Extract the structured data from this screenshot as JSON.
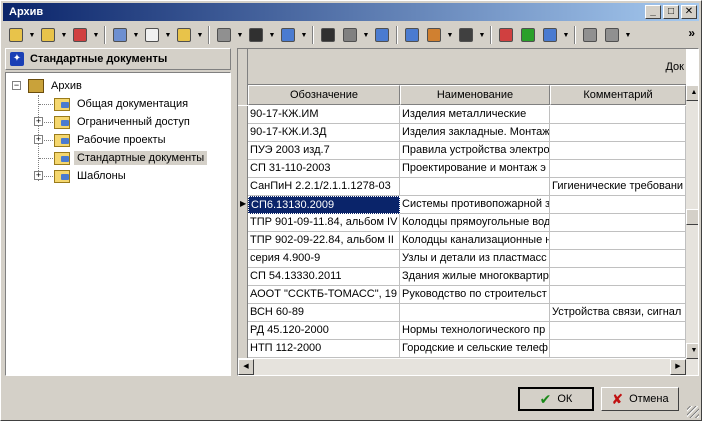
{
  "window": {
    "title": "Архив"
  },
  "titlebar_buttons": {
    "minimize": "_",
    "maximize": "□",
    "close": "✕"
  },
  "toolbar": {
    "overflow": "»",
    "buttons": [
      {
        "icon": "new-folder-icon",
        "color": "#e8c34a"
      },
      {
        "icon": "move-up-icon",
        "color": "#e8c34a"
      },
      {
        "icon": "delete-folder-icon",
        "color": "#d04040"
      },
      {
        "icon": "properties-icon",
        "color": "#6d8fd0"
      },
      {
        "icon": "document-icon",
        "color": "#f0f0f0"
      },
      {
        "icon": "help-icon",
        "color": "#e8c34a"
      },
      {
        "icon": "print-icon",
        "color": "#909090"
      },
      {
        "icon": "run-icon",
        "color": "#303030"
      },
      {
        "icon": "filter-icon",
        "color": "#4a7bd0"
      },
      {
        "icon": "find-icon",
        "color": "#303030"
      },
      {
        "icon": "tools-icon",
        "color": "#808080"
      },
      {
        "icon": "copy-to-icon",
        "color": "#4a7bd0"
      },
      {
        "icon": "structure-icon",
        "color": "#4a7bd0"
      },
      {
        "icon": "report-icon",
        "color": "#d08030"
      },
      {
        "icon": "user-icon",
        "color": "#404040"
      },
      {
        "icon": "calendar-icon",
        "color": "#d04040"
      },
      {
        "icon": "go-icon",
        "color": "#2aa02a"
      },
      {
        "icon": "refresh-icon",
        "color": "#4a7bd0"
      },
      {
        "icon": "archive-folder-icon",
        "color": "#909090"
      },
      {
        "icon": "settings-icon",
        "color": "#909090"
      }
    ]
  },
  "left_panel": {
    "header": "Стандартные документы",
    "tree": [
      {
        "label": "Архив",
        "level": 0,
        "expander": "−",
        "selected": false
      },
      {
        "label": "Общая документация",
        "level": 1,
        "expander": "",
        "selected": false
      },
      {
        "label": "Ограниченный доступ",
        "level": 1,
        "expander": "+",
        "selected": false
      },
      {
        "label": "Рабочие проекты",
        "level": 1,
        "expander": "+",
        "selected": false
      },
      {
        "label": "Стандартные документы",
        "level": 1,
        "expander": "",
        "selected": true
      },
      {
        "label": "Шаблоны",
        "level": 1,
        "expander": "+",
        "selected": false
      }
    ]
  },
  "grid": {
    "group_header": "Док",
    "columns": [
      "Обозначение",
      "Наименование",
      "Комментарий"
    ],
    "current_row_marker": "▶",
    "selected_row": 5,
    "rows": [
      [
        "90-17-КЖ.ИМ",
        "Изделия металлические",
        ""
      ],
      [
        "90-17-КЖ.И.ЗД",
        "Изделия закладные. Монтаж",
        ""
      ],
      [
        "ПУЭ 2003 изд.7",
        "Правила устройства электро",
        ""
      ],
      [
        "СП 31-110-2003",
        "Проектирование и монтаж э",
        ""
      ],
      [
        "СанПиН 2.2.1/2.1.1.1278-03",
        "",
        "Гигиенические требовани"
      ],
      [
        "СП6.13130.2009",
        "Системы противопожарной з",
        ""
      ],
      [
        "ТПР 901-09-11.84, альбом IV",
        "Колодцы прямоугольные вод",
        ""
      ],
      [
        "ТПР 902-09-22.84, альбом II",
        "Колодцы канализационные н",
        ""
      ],
      [
        "серия 4.900-9",
        "Узлы и детали из пластмасс",
        ""
      ],
      [
        "СП 54.13330.2011",
        "Здания жилые многоквартир",
        ""
      ],
      [
        "АООТ \"ССКТБ-ТОМАСС\", 19",
        "Руководство по строительст",
        ""
      ],
      [
        "ВСН 60-89",
        "",
        "Устройства связи, сигнал"
      ],
      [
        "РД 45.120-2000",
        "Нормы технологического пр",
        ""
      ],
      [
        "НТП 112-2000",
        "Городские и сельские телеф",
        ""
      ]
    ]
  },
  "buttons": {
    "ok": "ОК",
    "cancel": "Отмена"
  }
}
